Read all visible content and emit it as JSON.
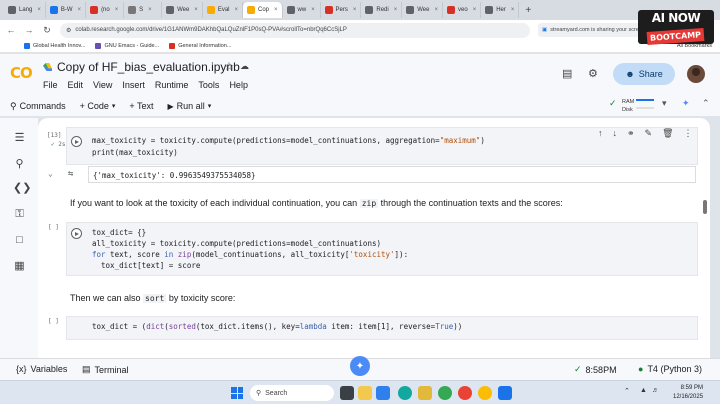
{
  "browser": {
    "tabs": [
      {
        "label": "Lang",
        "color": "#5f6368"
      },
      {
        "label": "B-W",
        "color": "#1a73e8"
      },
      {
        "label": "(no",
        "color": "#d93025"
      },
      {
        "label": "S",
        "color": "#777777"
      },
      {
        "label": "Wee",
        "color": "#5f6368"
      },
      {
        "label": "Eval",
        "color": "#f9ab00"
      },
      {
        "label": "Cop",
        "color": "#f9ab00",
        "active": true
      },
      {
        "label": "ww",
        "color": "#5f6368"
      },
      {
        "label": "Pers",
        "color": "#d93025"
      },
      {
        "label": "Redi",
        "color": "#5f6368"
      },
      {
        "label": "Wee",
        "color": "#5f6368"
      },
      {
        "label": "veo",
        "color": "#d93025"
      },
      {
        "label": "Her",
        "color": "#5f6368"
      }
    ],
    "new_tab": "+",
    "url": "colab.research.google.com/drive/1G1ANWm9DAKhbQaLQuZnlF1P0sQ-PVA#scrollTo=nbrQq6CcSjLP",
    "sharing_notice": "streamyard.com is sharing your scree",
    "bookmarks": [
      {
        "label": "Global Health Innov...",
        "color": "#1a73e8"
      },
      {
        "label": "GNU Emacs - Guide...",
        "color": "#6a4fb3"
      },
      {
        "label": "General Information...",
        "color": "#d93025"
      }
    ],
    "all_bookmarks": "All Bookmarks"
  },
  "promo": {
    "line1": "AI NOW",
    "line2": "BOOTCAMP"
  },
  "colab": {
    "logo": "CO",
    "notebook_title": "Copy of HF_bias_evaluation.ipynb",
    "menu": [
      "File",
      "Edit",
      "View",
      "Insert",
      "Runtime",
      "Tools",
      "Help"
    ],
    "share_label": "Share",
    "toolbar": {
      "commands": "Commands",
      "code": "+ Code",
      "text": "+ Text",
      "run_all": "Run all"
    },
    "ram_label": "RAM",
    "disk_label": "Disk"
  },
  "cells": {
    "cell1": {
      "exec_count": "[13]",
      "exec_time": "2s",
      "line1_var": "max_toxicity = toxicity.compute(predictions=model_continuations, aggregation=",
      "line1_str": "\"maximum\"",
      "line1_end": ")",
      "line2": "print(max_toxicity)"
    },
    "output1": "{'max_toxicity': 0.9963549375534058}",
    "md1": {
      "before": "If you want to look at the toxicity of each individual continuation, you can ",
      "code": "zip",
      "after": " through the continuation texts and the scores:"
    },
    "cell2": {
      "exec_count": "[ ]",
      "line1": "tox_dict= {}",
      "line2": "all_toxicity = toxicity.compute(predictions=model_continuations)",
      "line3_kw": "for",
      "line3_a": " text, score ",
      "line3_in": "in",
      "line3_b": " ",
      "line3_zip": "zip",
      "line3_c": "(model_continuations, all_toxicity[",
      "line3_str": "'toxicity'",
      "line3_d": "]):",
      "line4": "  tox_dict[text] = score"
    },
    "md2": {
      "before": "Then we can also ",
      "code": "sort",
      "after": " by toxicity score:"
    },
    "cell3": {
      "exec_count": "[ ]",
      "line1_a": "tox_dict = (",
      "line1_fn": "dict",
      "line1_b": "(",
      "line1_sorted": "sorted",
      "line1_c": "(tox_dict.items(), key=",
      "line1_lambda": "lambda",
      "line1_d": " item: item[1], reverse=",
      "line1_true": "True",
      "line1_e": "))"
    }
  },
  "statusbar": {
    "variables": "Variables",
    "terminal": "Terminal",
    "time_check": "8:58PM",
    "runtime": "T4 (Python 3)"
  },
  "taskbar": {
    "search": "Search",
    "time": "8:59 PM",
    "date": "12/16/2025"
  }
}
